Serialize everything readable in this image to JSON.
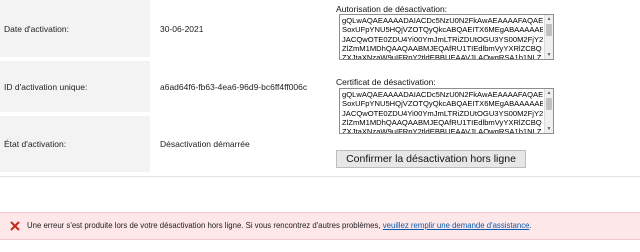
{
  "rows": {
    "activation_date": {
      "label": "Date d'activation:",
      "value": "30-06-2021"
    },
    "activation_id": {
      "label": "ID d'activation unique:",
      "value": "a6ad64f6-fb63-4ea6-96d9-bc6ff4ff006c"
    },
    "activation_state": {
      "label": "État d'activation:",
      "value": "Désactivation démarrée"
    }
  },
  "authorization": {
    "label": "Autorisation de désactivation:",
    "text": "gQLwAQAEAAAADAIACDc5NzU0N2FkAwAEAAAAFAQAE\nSoxUFpYNU5HQjVZOTQyQkcABQAEITX6MEgABAAAAAB\nJACQwOTE0ZDU4Yi00YmJmLTRiZDUtOGU3YS00M2FjY2\nZlZmM1MDhQAAQAABMJEQAfRU1TIEdlbmVyYXRlZCBQ\nZXJtaXNzaW9uIFRpY2tldEBBUEAAVJLAOwqRSA1b1NLZ"
  },
  "certificate": {
    "label": "Certificat de désactivation:",
    "text": "gQLwAQAEAAAADAIACDc5NzU0N2FkAwAEAAAAFAQAE\nSoxUFpYNU5HQjVZOTQyQkcABQAEITX6MEgABAAAAAB\nJACQwOTE0ZDU4Yi00YmJmLTRiZDUtOGU3YS00M2FjY2\nZlZmM1MDhQAAQAABMJEQAfRU1TIEdlbmVyYXRlZCBQ\nZXJtaXNzaW9uIFRpY2tldEBBUEAAVJLAOwqRSA1b1NLZ"
  },
  "confirm_button": {
    "label": "Confirmer la désactivation hors ligne"
  },
  "error": {
    "icon": "close-x-icon",
    "color": "#c42b1c",
    "text": "Une erreur s'est produite lors de votre désactivation hors ligne. Si vous rencontrez d'autres problèmes, ",
    "link": "veuillez remplir une demande d'assistance",
    "suffix": "."
  }
}
